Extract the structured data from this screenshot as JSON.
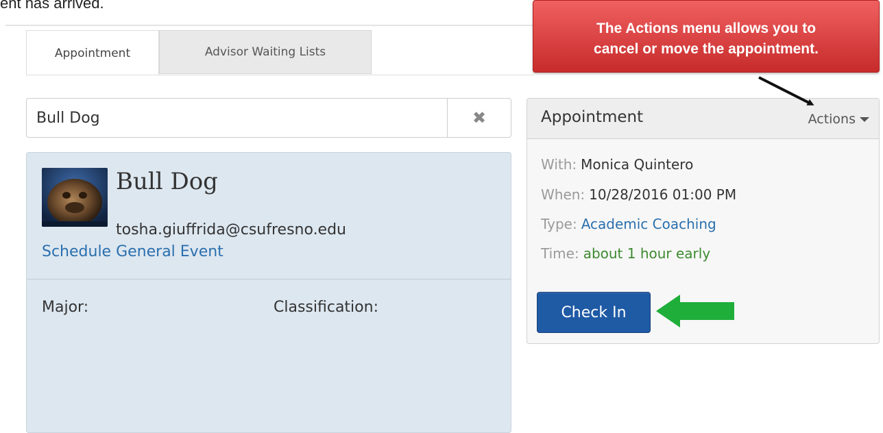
{
  "instruction_fragment": "ent has arrived.",
  "tabs": [
    {
      "label": "Appointment"
    },
    {
      "label": "Advisor Waiting Lists"
    }
  ],
  "search": {
    "value": "Bull Dog"
  },
  "student": {
    "name": "Bull Dog",
    "email": "tosha.giuffrida@csufresno.edu",
    "schedule_link": "Schedule General Event",
    "major_label": "Major:",
    "classification_label": "Classification:"
  },
  "appointment": {
    "title": "Appointment",
    "actions_label": "Actions",
    "with_label": "With:",
    "with_value": "Monica Quintero",
    "when_label": "When:",
    "when_value": "10/28/2016 01:00 PM",
    "type_label": "Type:",
    "type_value": "Academic Coaching",
    "time_label": "Time:",
    "time_value": "about 1 hour early",
    "checkin_label": "Check In"
  },
  "callout": {
    "line1": "The Actions menu allows you to",
    "line2": "cancel or move the appointment."
  },
  "colors": {
    "callout": "#d93a3a",
    "checkin": "#1f5aa5",
    "green_arrow": "#1fae3a",
    "card_bg": "#dde7f0",
    "link": "#2a6fad"
  }
}
